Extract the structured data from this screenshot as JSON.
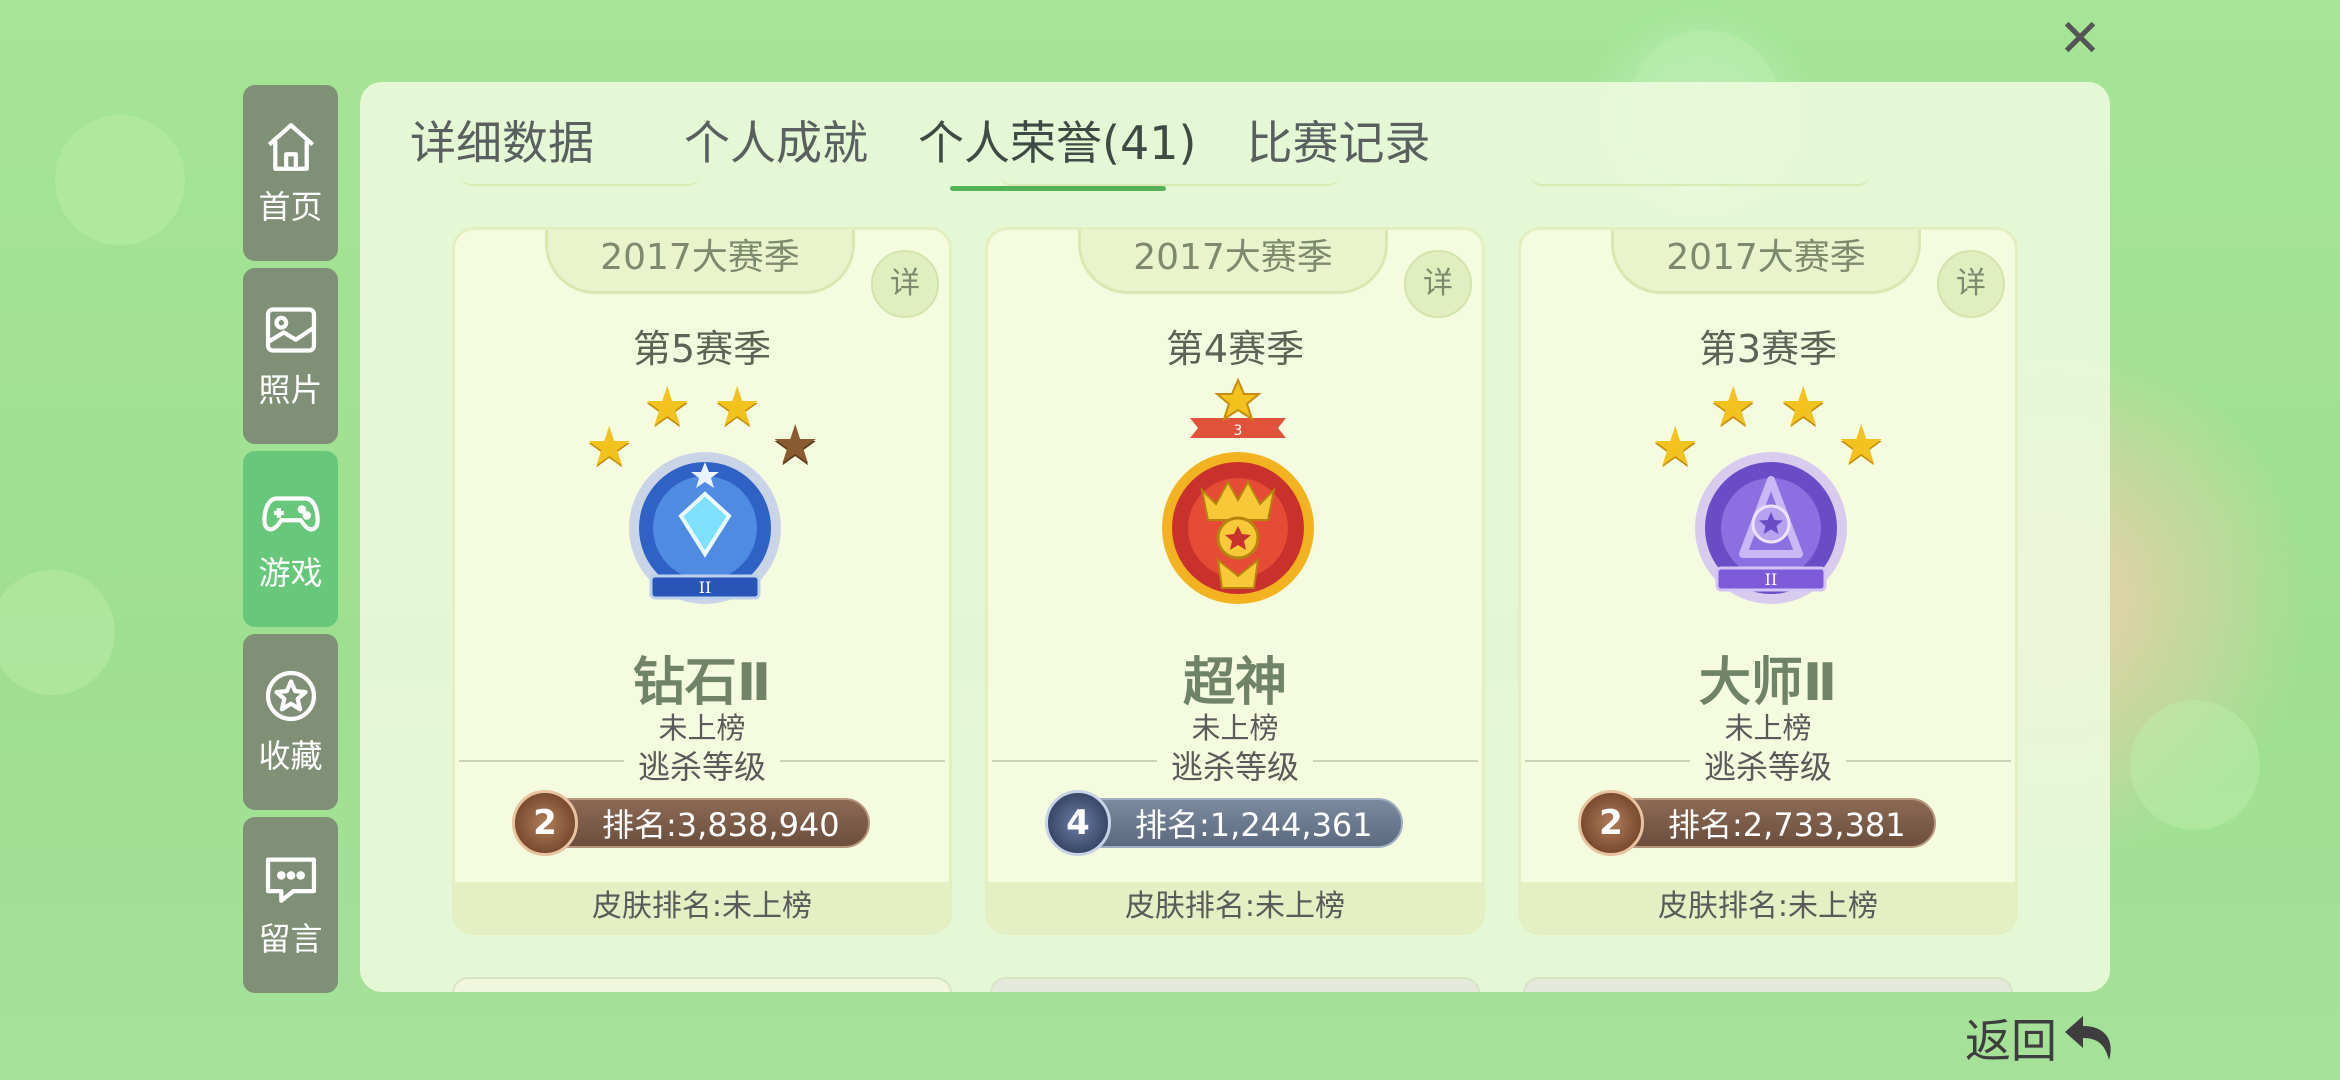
{
  "close_label": "✕",
  "sidebar": {
    "items": [
      {
        "label": "首页",
        "icon": "home-icon",
        "active": false
      },
      {
        "label": "照片",
        "icon": "image-icon",
        "active": false
      },
      {
        "label": "游戏",
        "icon": "gamepad-icon",
        "active": true
      },
      {
        "label": "收藏",
        "icon": "star-icon",
        "active": false
      },
      {
        "label": "留言",
        "icon": "message-icon",
        "active": false
      }
    ]
  },
  "tabs": [
    {
      "label": "详细数据"
    },
    {
      "label": "个人成就"
    },
    {
      "label": "个人荣誉(41)",
      "active": true
    },
    {
      "label": "比赛记录"
    }
  ],
  "cards": [
    {
      "season_group": "2017大赛季",
      "detail_label": "详",
      "season_name": "第5赛季",
      "stars": "3 gold + 1 bronze",
      "badge": "diamond-badge",
      "rank_title": "钻石Ⅱ",
      "list_status": "未上榜",
      "kill_level_label": "逃杀等级",
      "kill_level_value": "2",
      "rank_text": "排名:3,838,940",
      "skin_rank": "皮肤排名:未上榜"
    },
    {
      "season_group": "2017大赛季",
      "detail_label": "详",
      "season_name": "第4赛季",
      "stars": "1 gold",
      "star_count_label": "3",
      "badge": "supreme-badge",
      "rank_title": "超神",
      "list_status": "未上榜",
      "kill_level_label": "逃杀等级",
      "kill_level_value": "4",
      "rank_text": "排名:1,244,361",
      "skin_rank": "皮肤排名:未上榜"
    },
    {
      "season_group": "2017大赛季",
      "detail_label": "详",
      "season_name": "第3赛季",
      "stars": "4 gold",
      "badge": "master-badge",
      "rank_title": "大师Ⅱ",
      "list_status": "未上榜",
      "kill_level_label": "逃杀等级",
      "kill_level_value": "2",
      "rank_text": "排名:2,733,381",
      "skin_rank": "皮肤排名:未上榜"
    }
  ],
  "back_label": "返回",
  "colors": {
    "accent": "#54b256",
    "sidebar": "#7f9077",
    "sidebar_active": "#67c77a"
  }
}
